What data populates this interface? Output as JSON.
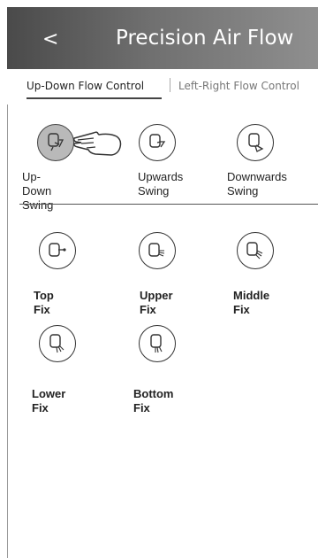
{
  "header": {
    "back_label": "<",
    "title": "Precision Air Flow"
  },
  "tabs": [
    {
      "label": "Up-Down Flow Control",
      "active": true
    },
    {
      "label": "Left-Right Flow Control",
      "active": false
    }
  ],
  "swing_options": [
    {
      "label": "Up-Down\nSwing",
      "icon": "up-down-swing-icon",
      "selected": true
    },
    {
      "label": "Upwards\nSwing",
      "icon": "upwards-swing-icon",
      "selected": false
    },
    {
      "label": "Downwards\nSwing",
      "icon": "downwards-swing-icon",
      "selected": false
    }
  ],
  "fix_options": [
    {
      "label": "Top Fix",
      "icon": "top-fix-icon"
    },
    {
      "label": "Upper Fix",
      "icon": "upper-fix-icon"
    },
    {
      "label": "Middle Fix",
      "icon": "middle-fix-icon"
    },
    {
      "label": "Lower Fix",
      "icon": "lower-fix-icon"
    },
    {
      "label": "Bottom Fix",
      "icon": "bottom-fix-icon"
    }
  ],
  "colors": {
    "header_start": "#4a4a4a",
    "header_end": "#8f8f8f",
    "selected_fill": "#b9b9b9"
  }
}
